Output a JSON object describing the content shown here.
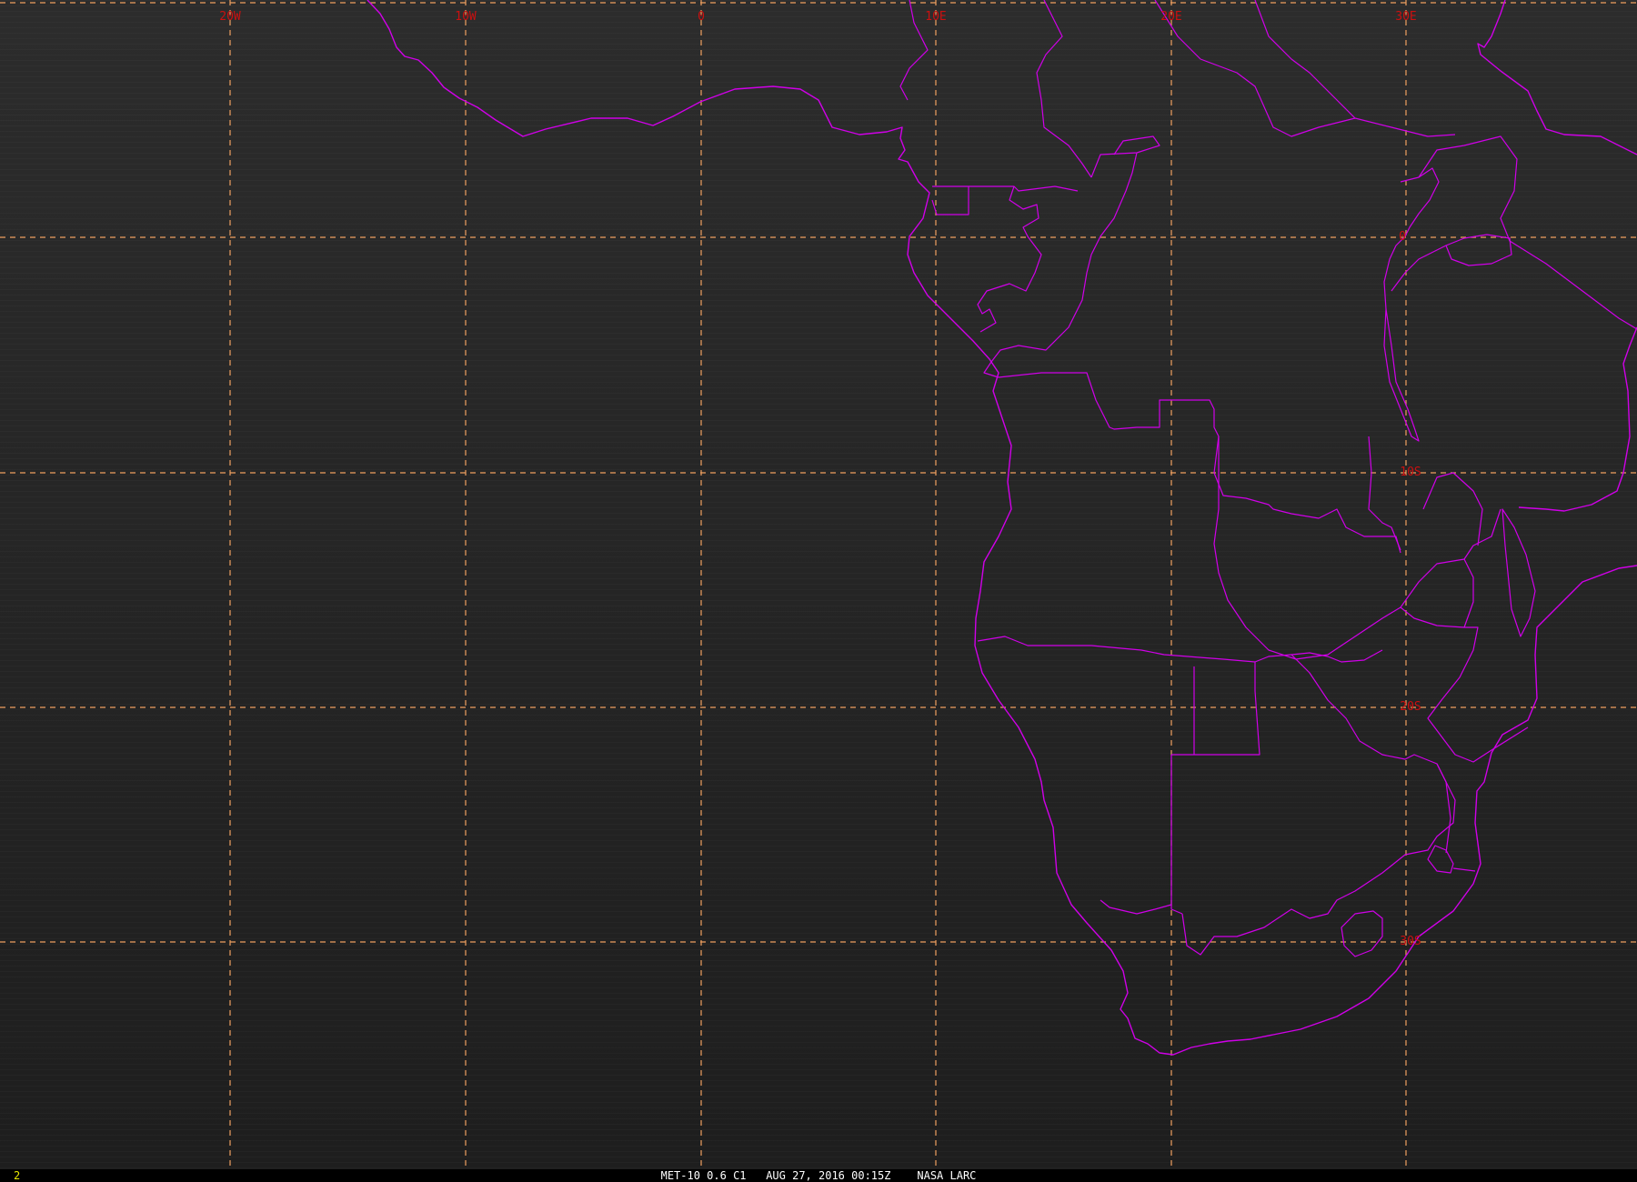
{
  "longitude_labels": [
    "20W",
    "10W",
    "0",
    "10E",
    "20E",
    "30E"
  ],
  "latitude_labels": [
    "0",
    "10S",
    "20S",
    "30S"
  ],
  "status_bar": {
    "frame_number": "2",
    "caption": "MET-10 0.6 C1   AUG 27, 2016 00:15Z    NASA LARC"
  },
  "colors": {
    "background": "#2a2a2a",
    "coastline": "#d000e8",
    "graticule": "#f0a060",
    "grid_label": "#cc1010",
    "frame_number": "#e6e600",
    "caption_text": "#ffffff"
  }
}
